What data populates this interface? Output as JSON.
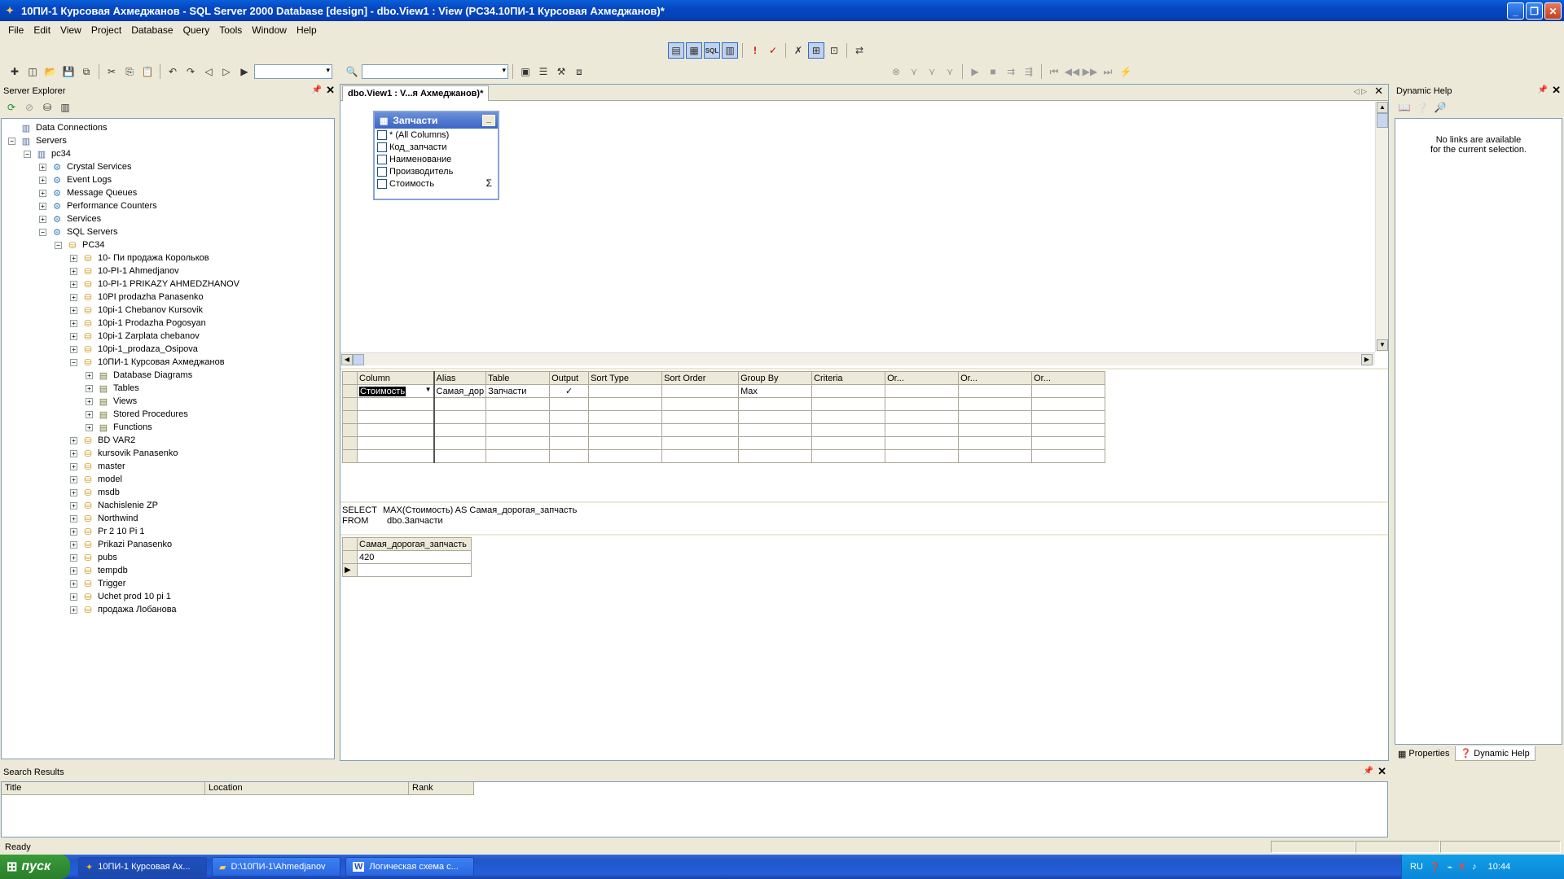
{
  "window": {
    "title": "10ПИ-1 Курсовая Ахмеджанов - SQL Server 2000 Database [design] - dbo.View1 : View (PC34.10ПИ-1 Курсовая Ахмеджанов)*"
  },
  "menu": [
    "File",
    "Edit",
    "View",
    "Project",
    "Database",
    "Query",
    "Tools",
    "Window",
    "Help"
  ],
  "server_explorer": {
    "title": "Server Explorer",
    "tree": [
      {
        "label": "Data Connections",
        "level": 0,
        "exp": ""
      },
      {
        "label": "Servers",
        "level": 0,
        "exp": "-"
      },
      {
        "label": "pc34",
        "level": 1,
        "exp": "-"
      },
      {
        "label": "Crystal Services",
        "level": 2,
        "exp": "+"
      },
      {
        "label": "Event Logs",
        "level": 2,
        "exp": "+"
      },
      {
        "label": "Message Queues",
        "level": 2,
        "exp": "+"
      },
      {
        "label": "Performance Counters",
        "level": 2,
        "exp": "+"
      },
      {
        "label": "Services",
        "level": 2,
        "exp": "+"
      },
      {
        "label": "SQL Servers",
        "level": 2,
        "exp": "-"
      },
      {
        "label": "PC34",
        "level": 3,
        "exp": "-"
      },
      {
        "label": "10- Пи продажа Корольков",
        "level": 4,
        "exp": "+"
      },
      {
        "label": "10-PI-1 Ahmedjanov",
        "level": 4,
        "exp": "+"
      },
      {
        "label": "10-PI-1 PRIKAZY AHMEDZHANOV",
        "level": 4,
        "exp": "+"
      },
      {
        "label": "10PI prodazha Panasenko",
        "level": 4,
        "exp": "+"
      },
      {
        "label": "10pi-1 Chebanov Kursovik",
        "level": 4,
        "exp": "+"
      },
      {
        "label": "10pi-1 Prodazha Pogosyan",
        "level": 4,
        "exp": "+"
      },
      {
        "label": "10pi-1 Zarplata chebanov",
        "level": 4,
        "exp": "+"
      },
      {
        "label": "10pi-1_prodaza_Osipova",
        "level": 4,
        "exp": "+"
      },
      {
        "label": "10ПИ-1 Курсовая Ахмеджанов",
        "level": 4,
        "exp": "-"
      },
      {
        "label": "Database Diagrams",
        "level": 5,
        "exp": "+"
      },
      {
        "label": "Tables",
        "level": 5,
        "exp": "+"
      },
      {
        "label": "Views",
        "level": 5,
        "exp": "+"
      },
      {
        "label": "Stored Procedures",
        "level": 5,
        "exp": "+"
      },
      {
        "label": "Functions",
        "level": 5,
        "exp": "+"
      },
      {
        "label": "BD VAR2",
        "level": 4,
        "exp": "+"
      },
      {
        "label": "kursovik Panasenko",
        "level": 4,
        "exp": "+"
      },
      {
        "label": "master",
        "level": 4,
        "exp": "+"
      },
      {
        "label": "model",
        "level": 4,
        "exp": "+"
      },
      {
        "label": "msdb",
        "level": 4,
        "exp": "+"
      },
      {
        "label": "Nachislenie ZP",
        "level": 4,
        "exp": "+"
      },
      {
        "label": "Northwind",
        "level": 4,
        "exp": "+"
      },
      {
        "label": "Pr 2 10 Pi 1",
        "level": 4,
        "exp": "+"
      },
      {
        "label": "Prikazi Panasenko",
        "level": 4,
        "exp": "+"
      },
      {
        "label": "pubs",
        "level": 4,
        "exp": "+"
      },
      {
        "label": "tempdb",
        "level": 4,
        "exp": "+"
      },
      {
        "label": "Trigger",
        "level": 4,
        "exp": "+"
      },
      {
        "label": "Uchet prod 10 pi 1",
        "level": 4,
        "exp": "+"
      },
      {
        "label": "продажа Лобанова",
        "level": 4,
        "exp": "+"
      }
    ]
  },
  "designer": {
    "tab_label": "dbo.View1 : V...я Ахмеджанов)*",
    "table_box": {
      "title": "Запчасти",
      "columns": [
        "* (All Columns)",
        "Код_запчасти",
        "Наименование",
        "Производитель",
        "Стоимость"
      ]
    },
    "grid": {
      "headers": [
        "Column",
        "Alias",
        "Table",
        "Output",
        "Sort Type",
        "Sort Order",
        "Group By",
        "Criteria",
        "Or...",
        "Or...",
        "Or..."
      ],
      "row": [
        "Стоимость",
        "Самая_дор",
        "Запчасти",
        "✓",
        "",
        "",
        "Max",
        "",
        "",
        "",
        ""
      ]
    },
    "sql": {
      "line1_kw": "SELECT",
      "line1": "MAX(Стоимость) AS Самая_дорогая_запчасть",
      "line2_kw": "FROM",
      "line2": "dbo.Запчасти"
    },
    "results": {
      "header": "Самая_дорогая_запчасть",
      "value": "420"
    }
  },
  "dynamic_help": {
    "title": "Dynamic Help",
    "line1": "No links are available",
    "line2": "for the current selection.",
    "tab_properties": "Properties",
    "tab_help": "Dynamic Help"
  },
  "search_results": {
    "title": "Search Results",
    "headers": [
      "Title",
      "Location",
      "Rank"
    ]
  },
  "status": {
    "text": "Ready"
  },
  "taskbar": {
    "start": "пуск",
    "tasks": [
      "10ПИ-1 Курсовая Ах...",
      "D:\\10ПИ-1\\Ahmedjanov",
      "Логическая схема с..."
    ],
    "lang": "RU",
    "clock": "10:44"
  },
  "colors": {
    "titlebar": "#0546c2",
    "start": "#2f8a2f",
    "tray": "#0b86d8",
    "panel_bg": "#ece9d8"
  }
}
